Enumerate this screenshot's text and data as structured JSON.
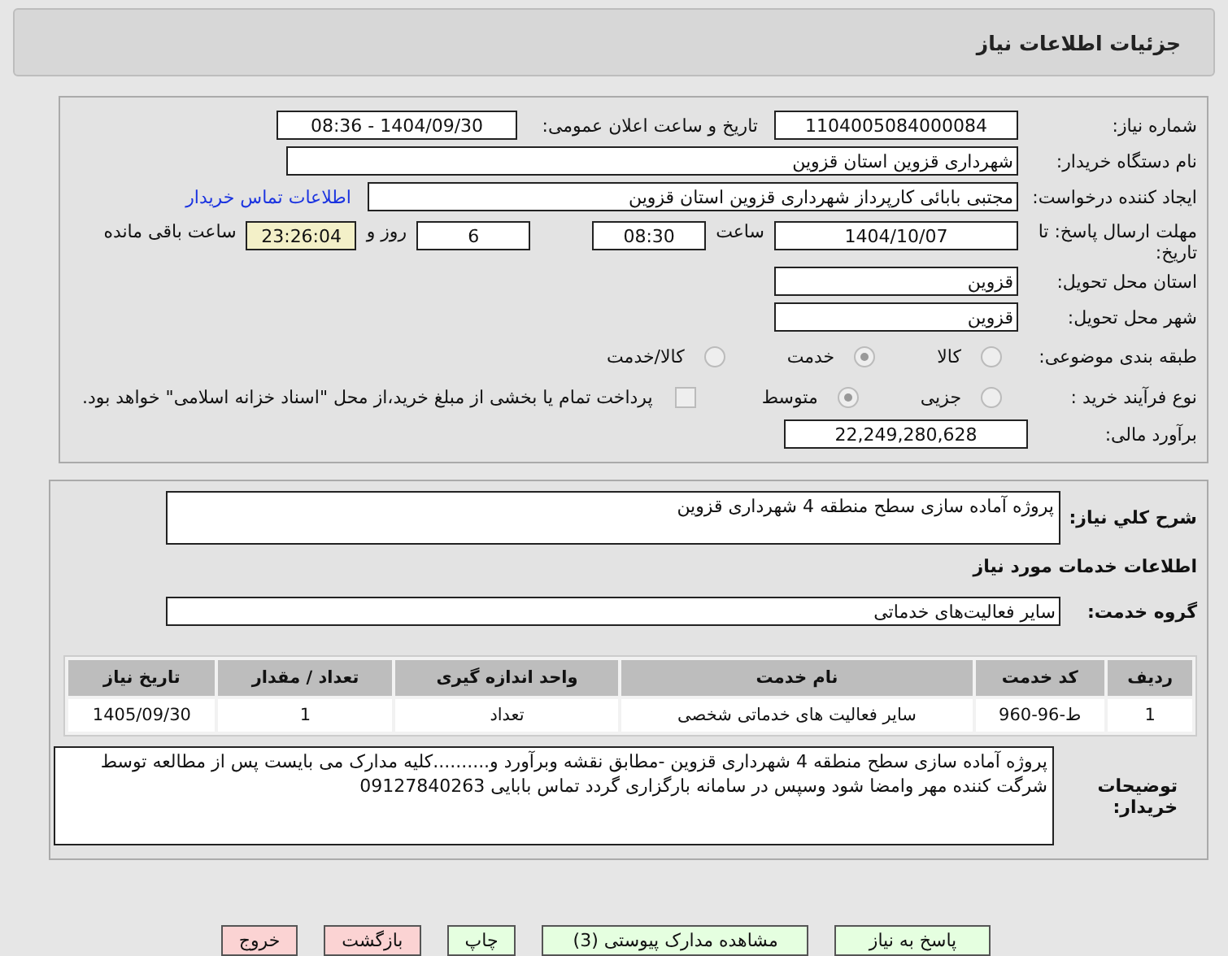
{
  "header": {
    "title": "جزئیات اطلاعات نیاز"
  },
  "details": {
    "need_number": {
      "label": "شماره نیاز:",
      "value": "1104005084000084"
    },
    "announce": {
      "label": "تاریخ و ساعت اعلان عمومی:",
      "value": "1404/09/30 - 08:36"
    },
    "buyer_org": {
      "label": "نام دستگاه خریدار:",
      "value": "شهرداری قزوین استان قزوین"
    },
    "requester": {
      "label": "ایجاد کننده درخواست:",
      "value": "مجتبی بابائی کارپرداز شهرداری قزوین استان قزوین",
      "link": "اطلاعات تماس خریدار"
    },
    "deadline": {
      "label": "مهلت ارسال پاسخ: تا تاریخ:",
      "date": "1404/10/07",
      "time_label": "ساعت",
      "time": "08:30",
      "days": "6",
      "days_label": "روز و",
      "remaining": "23:26:04",
      "remaining_label": "ساعت باقی مانده"
    },
    "province": {
      "label": "استان محل تحویل:",
      "value": "قزوین"
    },
    "city": {
      "label": "شهر محل تحویل:",
      "value": "قزوین"
    },
    "category": {
      "label": "طبقه بندی موضوعی:",
      "options": [
        {
          "label": "کالا",
          "selected": false
        },
        {
          "label": "خدمت",
          "selected": true
        },
        {
          "label": "کالا/خدمت",
          "selected": false
        }
      ]
    },
    "process": {
      "label": "نوع فرآیند خرید :",
      "options": [
        {
          "label": "جزیی",
          "selected": false
        },
        {
          "label": "متوسط",
          "selected": true
        }
      ],
      "payment": {
        "checked": false,
        "text": "پرداخت تمام یا بخشی از مبلغ خرید،از محل \"اسناد خزانه اسلامی\" خواهد بود."
      }
    },
    "estimate": {
      "label": "برآورد مالی:",
      "value": "22,249,280,628"
    }
  },
  "services": {
    "description": {
      "label": "شرح کلي نیاز:",
      "value": "پروژه آماده سازی سطح منطقه 4 شهرداری قزوین"
    },
    "heading": "اطلاعات خدمات مورد نیاز",
    "group": {
      "label": "گروه خدمت:",
      "value": "سایر فعالیت‌های خدماتی"
    },
    "table": {
      "columns": [
        "ردیف",
        "کد خدمت",
        "نام خدمت",
        "واحد اندازه گیری",
        "تعداد / مقدار",
        "تاریخ نیاز"
      ],
      "rows": [
        [
          "1",
          "ط-96-960",
          "سایر فعالیت های خدماتی شخصی",
          "تعداد",
          "1",
          "1405/09/30"
        ]
      ]
    },
    "notes": {
      "label": "توضیحات خریدار:",
      "value": "پروژه آماده سازی سطح منطقه 4 شهرداری قزوین -مطابق نقشه وبرآورد و..........کلیه مدارک می بایست پس از مطالعه توسط شرگت کننده مهر وامضا شود وسپس در سامانه بارگزاری گردد تماس بابایی 09127840263"
    }
  },
  "buttons": [
    {
      "label": "پاسخ به نیاز",
      "kind": "green"
    },
    {
      "label": "مشاهده مدارک پیوستی (3)",
      "kind": "green"
    },
    {
      "label": "چاپ",
      "kind": "green"
    },
    {
      "label": "بازگشت",
      "kind": "red"
    },
    {
      "label": "خروج",
      "kind": "red"
    }
  ]
}
